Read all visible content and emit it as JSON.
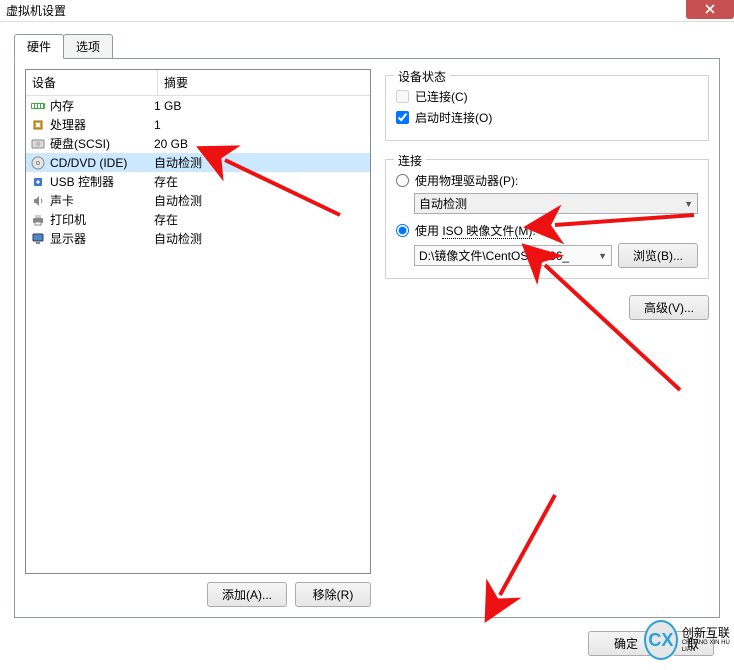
{
  "window": {
    "title": "虚拟机设置",
    "close": "X"
  },
  "tabs": {
    "hardware": "硬件",
    "options": "选项"
  },
  "hw": {
    "cols": {
      "device": "设备",
      "summary": "摘要"
    },
    "rows": [
      {
        "icon": "memory-icon",
        "name": "内存",
        "summary": "1 GB"
      },
      {
        "icon": "cpu-icon",
        "name": "处理器",
        "summary": "1"
      },
      {
        "icon": "disk-icon",
        "name": "硬盘(SCSI)",
        "summary": "20 GB"
      },
      {
        "icon": "cd-icon",
        "name": "CD/DVD (IDE)",
        "summary": "自动检测"
      },
      {
        "icon": "usb-icon",
        "name": "USB 控制器",
        "summary": "存在"
      },
      {
        "icon": "sound-icon",
        "name": "声卡",
        "summary": "自动检测"
      },
      {
        "icon": "printer-icon",
        "name": "打印机",
        "summary": "存在"
      },
      {
        "icon": "display-icon",
        "name": "显示器",
        "summary": "自动检测"
      }
    ],
    "add": "添加(A)...",
    "remove": "移除(R)"
  },
  "status": {
    "legend": "设备状态",
    "connected": "已连接(C)",
    "connect_on_power": "启动时连接(O)"
  },
  "conn": {
    "legend": "连接",
    "use_physical": "使用物理驱动器(P):",
    "autodetect": "自动检测",
    "use_iso_pre": "使用 ",
    "use_iso_mid": "ISO 映像文件(M)",
    "use_iso_suf": ":",
    "iso_path": "D:\\镜像文件\\CentOS-7-x86_",
    "browse": "浏览(B)...",
    "advanced": "高级(V)..."
  },
  "dlg": {
    "ok": "确定",
    "cancel": "取"
  },
  "brand": {
    "letter": "CX",
    "t1": "创新互联",
    "t2": "CHUANG XIN HU LIAN"
  }
}
